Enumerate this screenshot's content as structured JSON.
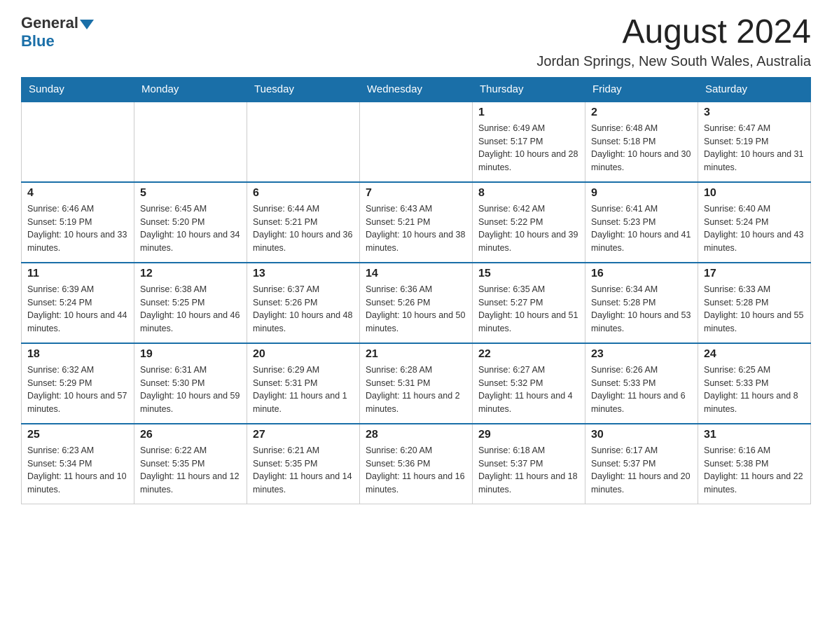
{
  "header": {
    "logo_general": "General",
    "logo_blue": "Blue",
    "month": "August 2024",
    "location": "Jordan Springs, New South Wales, Australia"
  },
  "days_of_week": [
    "Sunday",
    "Monday",
    "Tuesday",
    "Wednesday",
    "Thursday",
    "Friday",
    "Saturday"
  ],
  "weeks": [
    [
      {
        "day": "",
        "info": ""
      },
      {
        "day": "",
        "info": ""
      },
      {
        "day": "",
        "info": ""
      },
      {
        "day": "",
        "info": ""
      },
      {
        "day": "1",
        "info": "Sunrise: 6:49 AM\nSunset: 5:17 PM\nDaylight: 10 hours and 28 minutes."
      },
      {
        "day": "2",
        "info": "Sunrise: 6:48 AM\nSunset: 5:18 PM\nDaylight: 10 hours and 30 minutes."
      },
      {
        "day": "3",
        "info": "Sunrise: 6:47 AM\nSunset: 5:19 PM\nDaylight: 10 hours and 31 minutes."
      }
    ],
    [
      {
        "day": "4",
        "info": "Sunrise: 6:46 AM\nSunset: 5:19 PM\nDaylight: 10 hours and 33 minutes."
      },
      {
        "day": "5",
        "info": "Sunrise: 6:45 AM\nSunset: 5:20 PM\nDaylight: 10 hours and 34 minutes."
      },
      {
        "day": "6",
        "info": "Sunrise: 6:44 AM\nSunset: 5:21 PM\nDaylight: 10 hours and 36 minutes."
      },
      {
        "day": "7",
        "info": "Sunrise: 6:43 AM\nSunset: 5:21 PM\nDaylight: 10 hours and 38 minutes."
      },
      {
        "day": "8",
        "info": "Sunrise: 6:42 AM\nSunset: 5:22 PM\nDaylight: 10 hours and 39 minutes."
      },
      {
        "day": "9",
        "info": "Sunrise: 6:41 AM\nSunset: 5:23 PM\nDaylight: 10 hours and 41 minutes."
      },
      {
        "day": "10",
        "info": "Sunrise: 6:40 AM\nSunset: 5:24 PM\nDaylight: 10 hours and 43 minutes."
      }
    ],
    [
      {
        "day": "11",
        "info": "Sunrise: 6:39 AM\nSunset: 5:24 PM\nDaylight: 10 hours and 44 minutes."
      },
      {
        "day": "12",
        "info": "Sunrise: 6:38 AM\nSunset: 5:25 PM\nDaylight: 10 hours and 46 minutes."
      },
      {
        "day": "13",
        "info": "Sunrise: 6:37 AM\nSunset: 5:26 PM\nDaylight: 10 hours and 48 minutes."
      },
      {
        "day": "14",
        "info": "Sunrise: 6:36 AM\nSunset: 5:26 PM\nDaylight: 10 hours and 50 minutes."
      },
      {
        "day": "15",
        "info": "Sunrise: 6:35 AM\nSunset: 5:27 PM\nDaylight: 10 hours and 51 minutes."
      },
      {
        "day": "16",
        "info": "Sunrise: 6:34 AM\nSunset: 5:28 PM\nDaylight: 10 hours and 53 minutes."
      },
      {
        "day": "17",
        "info": "Sunrise: 6:33 AM\nSunset: 5:28 PM\nDaylight: 10 hours and 55 minutes."
      }
    ],
    [
      {
        "day": "18",
        "info": "Sunrise: 6:32 AM\nSunset: 5:29 PM\nDaylight: 10 hours and 57 minutes."
      },
      {
        "day": "19",
        "info": "Sunrise: 6:31 AM\nSunset: 5:30 PM\nDaylight: 10 hours and 59 minutes."
      },
      {
        "day": "20",
        "info": "Sunrise: 6:29 AM\nSunset: 5:31 PM\nDaylight: 11 hours and 1 minute."
      },
      {
        "day": "21",
        "info": "Sunrise: 6:28 AM\nSunset: 5:31 PM\nDaylight: 11 hours and 2 minutes."
      },
      {
        "day": "22",
        "info": "Sunrise: 6:27 AM\nSunset: 5:32 PM\nDaylight: 11 hours and 4 minutes."
      },
      {
        "day": "23",
        "info": "Sunrise: 6:26 AM\nSunset: 5:33 PM\nDaylight: 11 hours and 6 minutes."
      },
      {
        "day": "24",
        "info": "Sunrise: 6:25 AM\nSunset: 5:33 PM\nDaylight: 11 hours and 8 minutes."
      }
    ],
    [
      {
        "day": "25",
        "info": "Sunrise: 6:23 AM\nSunset: 5:34 PM\nDaylight: 11 hours and 10 minutes."
      },
      {
        "day": "26",
        "info": "Sunrise: 6:22 AM\nSunset: 5:35 PM\nDaylight: 11 hours and 12 minutes."
      },
      {
        "day": "27",
        "info": "Sunrise: 6:21 AM\nSunset: 5:35 PM\nDaylight: 11 hours and 14 minutes."
      },
      {
        "day": "28",
        "info": "Sunrise: 6:20 AM\nSunset: 5:36 PM\nDaylight: 11 hours and 16 minutes."
      },
      {
        "day": "29",
        "info": "Sunrise: 6:18 AM\nSunset: 5:37 PM\nDaylight: 11 hours and 18 minutes."
      },
      {
        "day": "30",
        "info": "Sunrise: 6:17 AM\nSunset: 5:37 PM\nDaylight: 11 hours and 20 minutes."
      },
      {
        "day": "31",
        "info": "Sunrise: 6:16 AM\nSunset: 5:38 PM\nDaylight: 11 hours and 22 minutes."
      }
    ]
  ]
}
